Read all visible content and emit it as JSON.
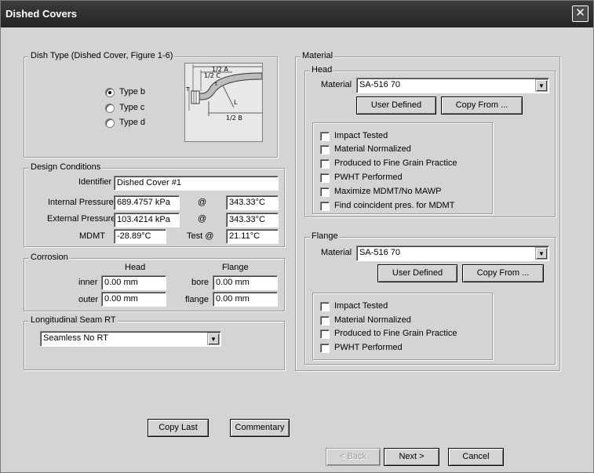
{
  "window": {
    "title": "Dished Covers",
    "close_glyph": "✕"
  },
  "dish_type": {
    "legend": "Dish Type  (Dished Cover, Figure 1-6)",
    "options": [
      "Type b",
      "Type c",
      "Type d"
    ],
    "selected": "Type b",
    "figure_labels": {
      "half_a": "1/2 A",
      "half_c": "1/2 C",
      "half_b": "1/2 B",
      "t": "t",
      "L": "L",
      "T": "T"
    }
  },
  "design": {
    "legend": "Design Conditions",
    "identifier_label": "Identifier",
    "identifier": "Dished Cover #1",
    "internal_pressure_label": "Internal Pressure",
    "internal_pressure": "689.4757 kPa",
    "internal_temp": "343.33°C",
    "external_pressure_label": "External Pressure",
    "external_pressure": "103.4214 kPa",
    "external_temp": "343.33°C",
    "at_symbol": "@",
    "mdmt_label": "MDMT",
    "mdmt": "-28.89°C",
    "test_label": "Test @",
    "test_temp": "21.11°C"
  },
  "corrosion": {
    "legend": "Corrosion",
    "head_heading": "Head",
    "flange_heading": "Flange",
    "inner_label": "inner",
    "inner": "0.00 mm",
    "outer_label": "outer",
    "outer": "0.00 mm",
    "bore_label": "bore",
    "bore": "0.00 mm",
    "flange_label": "flange",
    "flange": "0.00 mm"
  },
  "seam": {
    "legend": "Longitudinal Seam RT",
    "value": "Seamless No RT"
  },
  "material": {
    "legend": "Material",
    "head": {
      "legend": "Head",
      "material_label": "Material",
      "material": "SA-516 70",
      "user_defined": "User Defined",
      "copy_from": "Copy From ...",
      "checks": [
        "Impact Tested",
        "Material Normalized",
        "Produced to Fine Grain Practice",
        "PWHT Performed",
        "Maximize MDMT/No MAWP",
        "Find coincident pres. for MDMT"
      ]
    },
    "flange": {
      "legend": "Flange",
      "material_label": "Material",
      "material": "SA-516 70",
      "user_defined": "User Defined",
      "copy_from": "Copy From ...",
      "checks": [
        "Impact Tested",
        "Material Normalized",
        "Produced to Fine Grain Practice",
        "PWHT Performed"
      ]
    }
  },
  "buttons": {
    "copy_last": "Copy Last",
    "commentary": "Commentary",
    "back": "< Back",
    "next": "Next >",
    "cancel": "Cancel"
  }
}
